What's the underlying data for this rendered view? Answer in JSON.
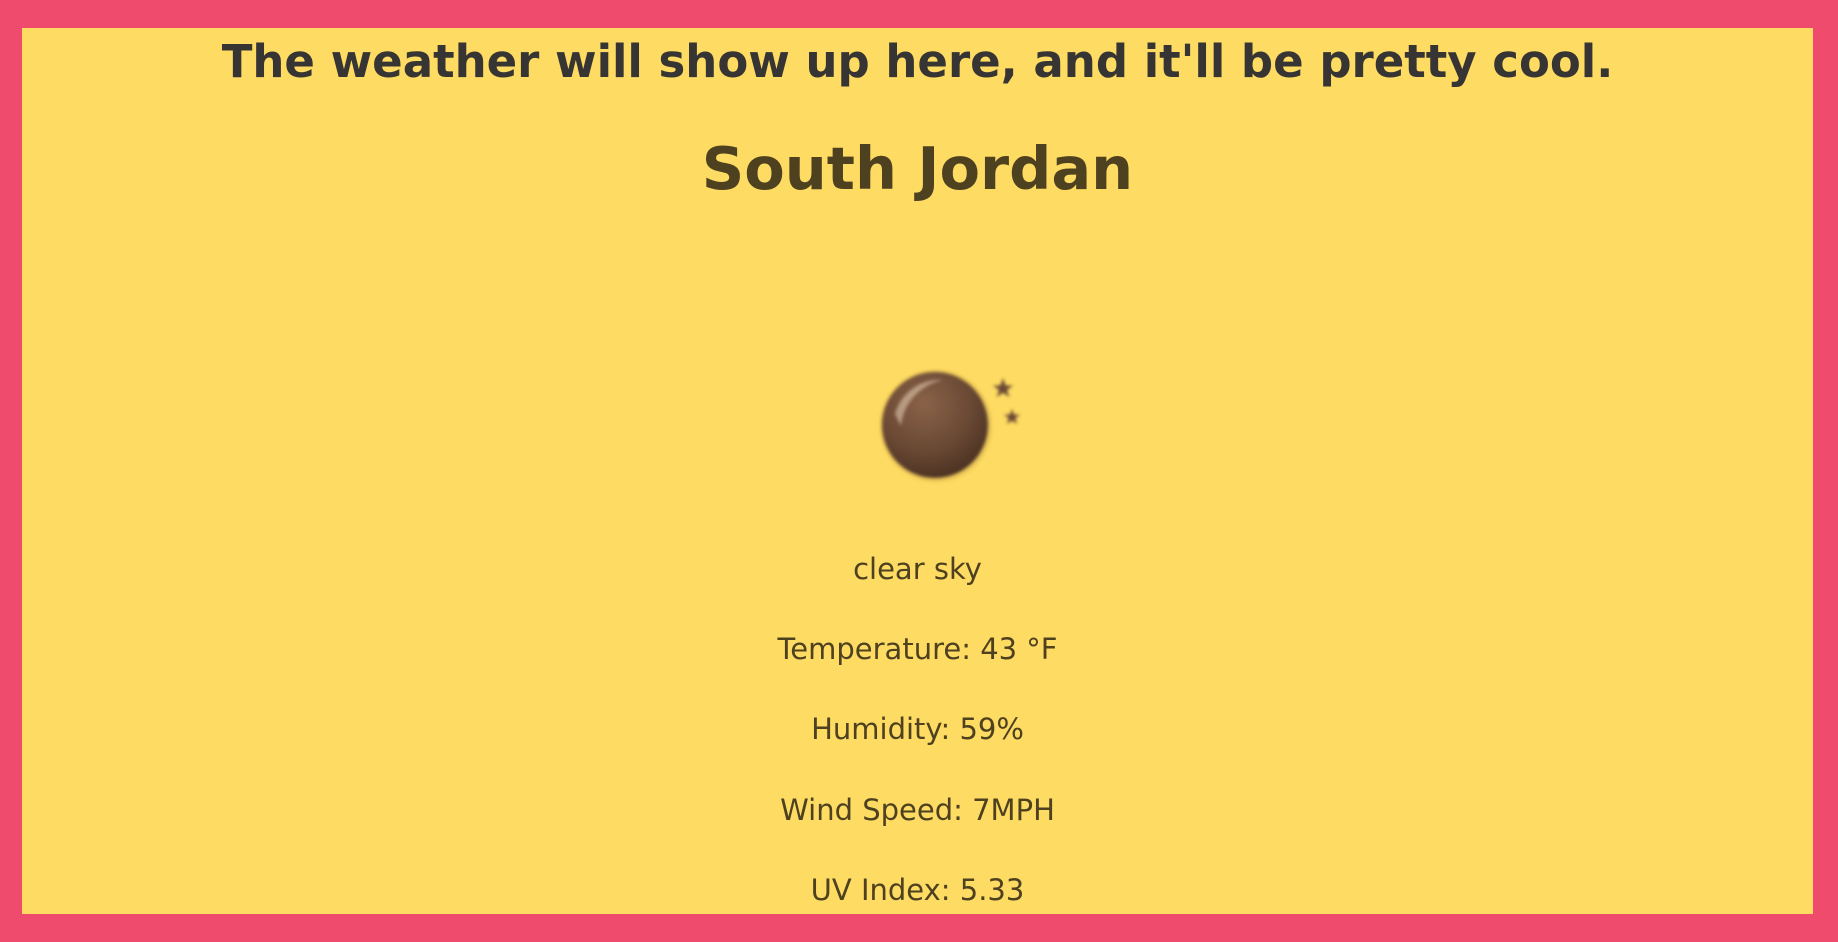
{
  "page": {
    "tagline": "The weather will show up here, and it'll be pretty cool.",
    "city": "South Jordan"
  },
  "weather": {
    "icon": "clear-sky-night-icon",
    "description": "clear sky",
    "temperature": "Temperature: 43 °F",
    "humidity": "Humidity: 59%",
    "wind_speed": "Wind Speed: 7MPH",
    "uv_index": "UV Index: 5.33"
  },
  "colors": {
    "border": "#EF4B6C",
    "background": "#FEDB62",
    "tagline_text": "#363533",
    "body_text": "#4E4120",
    "moon": "#6B4A35"
  }
}
